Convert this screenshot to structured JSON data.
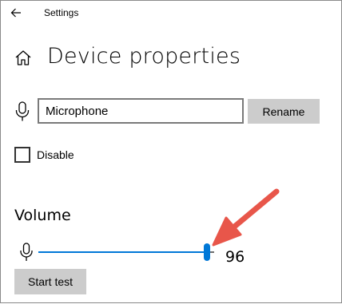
{
  "window": {
    "app_title": "Settings"
  },
  "header": {
    "page_title": "Device properties"
  },
  "device": {
    "name_value": "Microphone",
    "rename_label": "Rename",
    "disable_label": "Disable",
    "disable_checked": false
  },
  "volume": {
    "heading": "Volume",
    "value": "96",
    "level_percent": 96,
    "start_test_label": "Start test"
  },
  "colors": {
    "accent": "#0078d7",
    "button_bg": "#cccccc",
    "callout_arrow": "#e8564a"
  },
  "icons": [
    "back-arrow-icon",
    "home-icon",
    "microphone-icon"
  ]
}
